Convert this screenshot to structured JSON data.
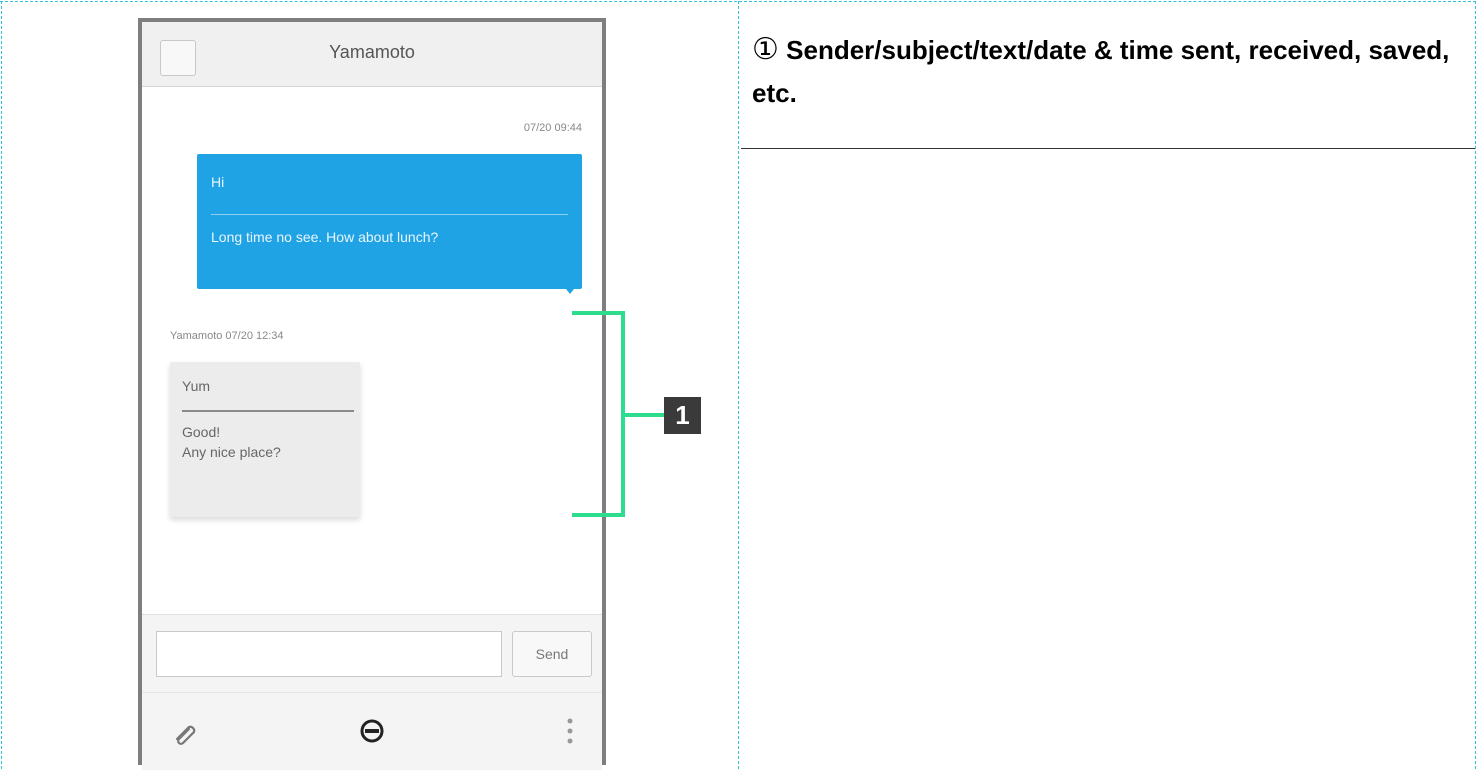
{
  "phone": {
    "title": "Yamamoto",
    "sent_message": {
      "timestamp": "07/20 09:44",
      "subject": "Hi",
      "body": "Long time no see. How about lunch?"
    },
    "received_message": {
      "meta": "Yamamoto 07/20 12:34",
      "subject": "Yum",
      "body_line1": "Good!",
      "body_line2": "Any nice place?"
    },
    "input": {
      "placeholder": ""
    },
    "send_label": "Send",
    "icons": [
      "attach-icon",
      "emoji-icon",
      "menu-icon",
      "back-icon"
    ]
  },
  "callout": {
    "number": "1",
    "color": "#2ddc8c"
  },
  "description": {
    "marker": "①",
    "text": "Sender/subject/text/date & time sent, received, saved, etc."
  },
  "colors": {
    "sent_bubble": "#1fa3e4",
    "received_bubble": "#ececec",
    "cell_border": "#2ec4d6"
  }
}
